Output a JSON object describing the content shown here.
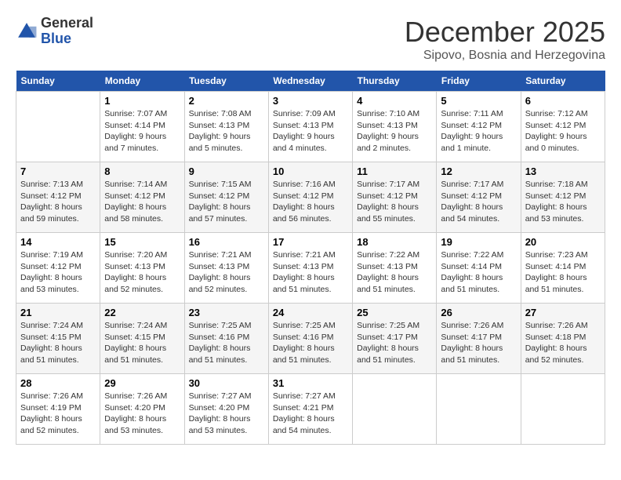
{
  "logo": {
    "general": "General",
    "blue": "Blue"
  },
  "title": "December 2025",
  "subtitle": "Sipovo, Bosnia and Herzegovina",
  "weekdays": [
    "Sunday",
    "Monday",
    "Tuesday",
    "Wednesday",
    "Thursday",
    "Friday",
    "Saturday"
  ],
  "weeks": [
    [
      {
        "day": "",
        "info": ""
      },
      {
        "day": "1",
        "info": "Sunrise: 7:07 AM\nSunset: 4:14 PM\nDaylight: 9 hours\nand 7 minutes."
      },
      {
        "day": "2",
        "info": "Sunrise: 7:08 AM\nSunset: 4:13 PM\nDaylight: 9 hours\nand 5 minutes."
      },
      {
        "day": "3",
        "info": "Sunrise: 7:09 AM\nSunset: 4:13 PM\nDaylight: 9 hours\nand 4 minutes."
      },
      {
        "day": "4",
        "info": "Sunrise: 7:10 AM\nSunset: 4:13 PM\nDaylight: 9 hours\nand 2 minutes."
      },
      {
        "day": "5",
        "info": "Sunrise: 7:11 AM\nSunset: 4:12 PM\nDaylight: 9 hours\nand 1 minute."
      },
      {
        "day": "6",
        "info": "Sunrise: 7:12 AM\nSunset: 4:12 PM\nDaylight: 9 hours\nand 0 minutes."
      }
    ],
    [
      {
        "day": "7",
        "info": "Sunrise: 7:13 AM\nSunset: 4:12 PM\nDaylight: 8 hours\nand 59 minutes."
      },
      {
        "day": "8",
        "info": "Sunrise: 7:14 AM\nSunset: 4:12 PM\nDaylight: 8 hours\nand 58 minutes."
      },
      {
        "day": "9",
        "info": "Sunrise: 7:15 AM\nSunset: 4:12 PM\nDaylight: 8 hours\nand 57 minutes."
      },
      {
        "day": "10",
        "info": "Sunrise: 7:16 AM\nSunset: 4:12 PM\nDaylight: 8 hours\nand 56 minutes."
      },
      {
        "day": "11",
        "info": "Sunrise: 7:17 AM\nSunset: 4:12 PM\nDaylight: 8 hours\nand 55 minutes."
      },
      {
        "day": "12",
        "info": "Sunrise: 7:17 AM\nSunset: 4:12 PM\nDaylight: 8 hours\nand 54 minutes."
      },
      {
        "day": "13",
        "info": "Sunrise: 7:18 AM\nSunset: 4:12 PM\nDaylight: 8 hours\nand 53 minutes."
      }
    ],
    [
      {
        "day": "14",
        "info": "Sunrise: 7:19 AM\nSunset: 4:12 PM\nDaylight: 8 hours\nand 53 minutes."
      },
      {
        "day": "15",
        "info": "Sunrise: 7:20 AM\nSunset: 4:13 PM\nDaylight: 8 hours\nand 52 minutes."
      },
      {
        "day": "16",
        "info": "Sunrise: 7:21 AM\nSunset: 4:13 PM\nDaylight: 8 hours\nand 52 minutes."
      },
      {
        "day": "17",
        "info": "Sunrise: 7:21 AM\nSunset: 4:13 PM\nDaylight: 8 hours\nand 51 minutes."
      },
      {
        "day": "18",
        "info": "Sunrise: 7:22 AM\nSunset: 4:13 PM\nDaylight: 8 hours\nand 51 minutes."
      },
      {
        "day": "19",
        "info": "Sunrise: 7:22 AM\nSunset: 4:14 PM\nDaylight: 8 hours\nand 51 minutes."
      },
      {
        "day": "20",
        "info": "Sunrise: 7:23 AM\nSunset: 4:14 PM\nDaylight: 8 hours\nand 51 minutes."
      }
    ],
    [
      {
        "day": "21",
        "info": "Sunrise: 7:24 AM\nSunset: 4:15 PM\nDaylight: 8 hours\nand 51 minutes."
      },
      {
        "day": "22",
        "info": "Sunrise: 7:24 AM\nSunset: 4:15 PM\nDaylight: 8 hours\nand 51 minutes."
      },
      {
        "day": "23",
        "info": "Sunrise: 7:25 AM\nSunset: 4:16 PM\nDaylight: 8 hours\nand 51 minutes."
      },
      {
        "day": "24",
        "info": "Sunrise: 7:25 AM\nSunset: 4:16 PM\nDaylight: 8 hours\nand 51 minutes."
      },
      {
        "day": "25",
        "info": "Sunrise: 7:25 AM\nSunset: 4:17 PM\nDaylight: 8 hours\nand 51 minutes."
      },
      {
        "day": "26",
        "info": "Sunrise: 7:26 AM\nSunset: 4:17 PM\nDaylight: 8 hours\nand 51 minutes."
      },
      {
        "day": "27",
        "info": "Sunrise: 7:26 AM\nSunset: 4:18 PM\nDaylight: 8 hours\nand 52 minutes."
      }
    ],
    [
      {
        "day": "28",
        "info": "Sunrise: 7:26 AM\nSunset: 4:19 PM\nDaylight: 8 hours\nand 52 minutes."
      },
      {
        "day": "29",
        "info": "Sunrise: 7:26 AM\nSunset: 4:20 PM\nDaylight: 8 hours\nand 53 minutes."
      },
      {
        "day": "30",
        "info": "Sunrise: 7:27 AM\nSunset: 4:20 PM\nDaylight: 8 hours\nand 53 minutes."
      },
      {
        "day": "31",
        "info": "Sunrise: 7:27 AM\nSunset: 4:21 PM\nDaylight: 8 hours\nand 54 minutes."
      },
      {
        "day": "",
        "info": ""
      },
      {
        "day": "",
        "info": ""
      },
      {
        "day": "",
        "info": ""
      }
    ]
  ]
}
